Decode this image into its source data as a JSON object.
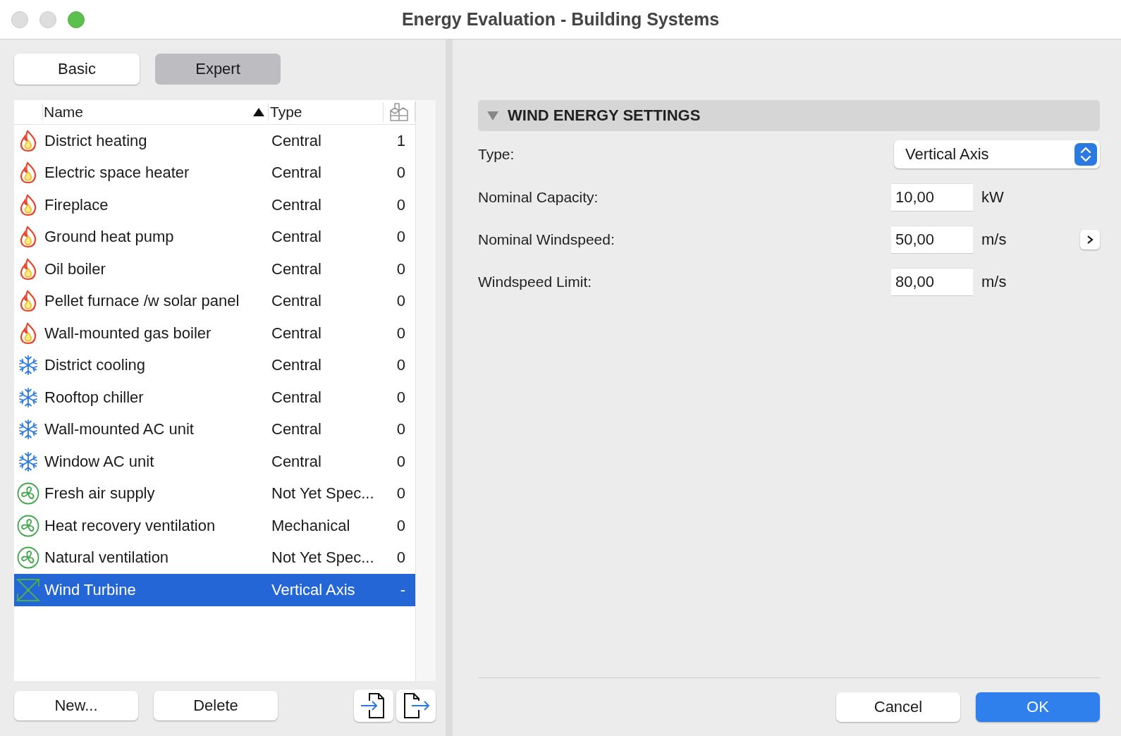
{
  "window": {
    "title": "Energy Evaluation - Building Systems"
  },
  "tabs": [
    {
      "label": "Basic",
      "selected": false
    },
    {
      "label": "Expert",
      "selected": true
    }
  ],
  "table": {
    "columns": [
      {
        "label": "Name",
        "sorted": true
      },
      {
        "label": "Type",
        "sorted": false
      }
    ],
    "rows": [
      {
        "kind": "heating",
        "name": "District heating",
        "type": "Central",
        "count": "1",
        "selected": false
      },
      {
        "kind": "heating",
        "name": "Electric space heater",
        "type": "Central",
        "count": "0",
        "selected": false
      },
      {
        "kind": "heating",
        "name": "Fireplace",
        "type": "Central",
        "count": "0",
        "selected": false
      },
      {
        "kind": "heating",
        "name": "Ground heat pump",
        "type": "Central",
        "count": "0",
        "selected": false
      },
      {
        "kind": "heating",
        "name": "Oil boiler",
        "type": "Central",
        "count": "0",
        "selected": false
      },
      {
        "kind": "heating",
        "name": "Pellet furnace /w solar panel",
        "type": "Central",
        "count": "0",
        "selected": false
      },
      {
        "kind": "heating",
        "name": "Wall-mounted gas boiler",
        "type": "Central",
        "count": "0",
        "selected": false
      },
      {
        "kind": "cooling",
        "name": "District cooling",
        "type": "Central",
        "count": "0",
        "selected": false
      },
      {
        "kind": "cooling",
        "name": "Rooftop chiller",
        "type": "Central",
        "count": "0",
        "selected": false
      },
      {
        "kind": "cooling",
        "name": "Wall-mounted AC unit",
        "type": "Central",
        "count": "0",
        "selected": false
      },
      {
        "kind": "cooling",
        "name": "Window AC unit",
        "type": "Central",
        "count": "0",
        "selected": false
      },
      {
        "kind": "ventilation",
        "name": "Fresh air supply",
        "type": "Not Yet Spec...",
        "count": "0",
        "selected": false
      },
      {
        "kind": "ventilation",
        "name": "Heat recovery ventilation",
        "type": "Mechanical",
        "count": "0",
        "selected": false
      },
      {
        "kind": "ventilation",
        "name": "Natural ventilation",
        "type": "Not Yet Spec...",
        "count": "0",
        "selected": false
      },
      {
        "kind": "wind",
        "name": "Wind Turbine",
        "type": "Vertical Axis",
        "count": "-",
        "selected": true
      }
    ]
  },
  "list_buttons": [
    "New...",
    "Delete"
  ],
  "section": {
    "title": "WIND ENERGY SETTINGS",
    "expanded": true,
    "type_field": {
      "label": "Type:",
      "value": "Vertical Axis"
    },
    "fields": [
      {
        "label": "Nominal Capacity:",
        "value": "10,00",
        "unit": "kW",
        "has_more": false
      },
      {
        "label": "Nominal Windspeed:",
        "value": "50,00",
        "unit": "m/s",
        "has_more": true
      },
      {
        "label": "Windspeed Limit:",
        "value": "80,00",
        "unit": "m/s",
        "has_more": false
      }
    ]
  },
  "buttons": [
    {
      "label": "Cancel",
      "kind": "secondary"
    },
    {
      "label": "OK",
      "kind": "primary"
    }
  ]
}
